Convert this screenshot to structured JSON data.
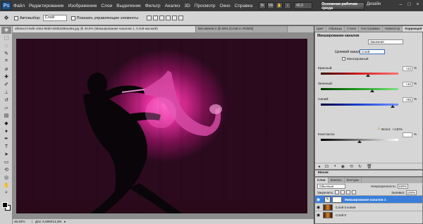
{
  "menubar": {
    "logo": "Ps",
    "items": [
      "Файл",
      "Редактирование",
      "Изображение",
      "Слои",
      "Выделение",
      "Фильтр",
      "Анализ",
      "3D",
      "Просмотр",
      "Окно",
      "Справка"
    ],
    "zoom": "46,9",
    "workspace_button": "Основная рабочая среда",
    "design_link": "Дизайн",
    "minimize": "–",
    "restore": "□",
    "close": "×"
  },
  "options": {
    "auto_select_label": "Автовыбор:",
    "auto_select_value": "Слой",
    "show_controls_label": "Показать управляющие элементы"
  },
  "tabs": {
    "active": "af63ee1f-8af5-4364-96d0-94963396a49a.jpg @ 46,9% (Микширование каналов 1, Слой-маска/8)",
    "inactive": "Без имени-1 @ 66% (Слой 2, RGB/8)"
  },
  "status": {
    "zoom": "46,92%",
    "doc": "Док: 6,59M/13,2M"
  },
  "panels": {
    "tabs": [
      "Цвет",
      "Образцы",
      "Стили",
      "Гистограмма",
      "Навигатор",
      "Коррекция"
    ],
    "adjustment_title": "Микширование каналов",
    "preset": "Заказная",
    "target_label": "Целевой канал:",
    "target_value": "Слой",
    "monochrome_label": "Монохромный",
    "sliders": [
      {
        "label": "Красный:",
        "value": "+22",
        "unit": "%",
        "fraction": 0.61
      },
      {
        "label": "Зеленый:",
        "value": "+32",
        "unit": "%",
        "fraction": 0.66
      },
      {
        "label": "Синий:",
        "value": "+86",
        "unit": "%",
        "fraction": 0.93
      },
      {
        "label": "Константа:",
        "value": "",
        "unit": "%",
        "fraction": 0.5
      }
    ],
    "total_label": "Всего:",
    "total_value": "+140",
    "total_unit": "%",
    "masks_tab": "Маски",
    "layers_tabs": [
      "Слои",
      "Каналы",
      "Контуры"
    ],
    "blend_mode": "Обычные",
    "opacity_label": "Непрозрачность:",
    "opacity_value": "100%",
    "lock_label": "Закрепить:",
    "fill_label": "Заливка:",
    "fill_value": "100%",
    "layers": [
      {
        "name": "Микширование каналов 1"
      },
      {
        "name": "Слой 0 копия"
      },
      {
        "name": "Слой 0"
      }
    ]
  },
  "colors": {
    "accent": "#3a7ed9",
    "glow": "#ff5fc2",
    "red_track": "#d02020",
    "green_track": "#20a020",
    "blue_track": "#2040d0"
  }
}
